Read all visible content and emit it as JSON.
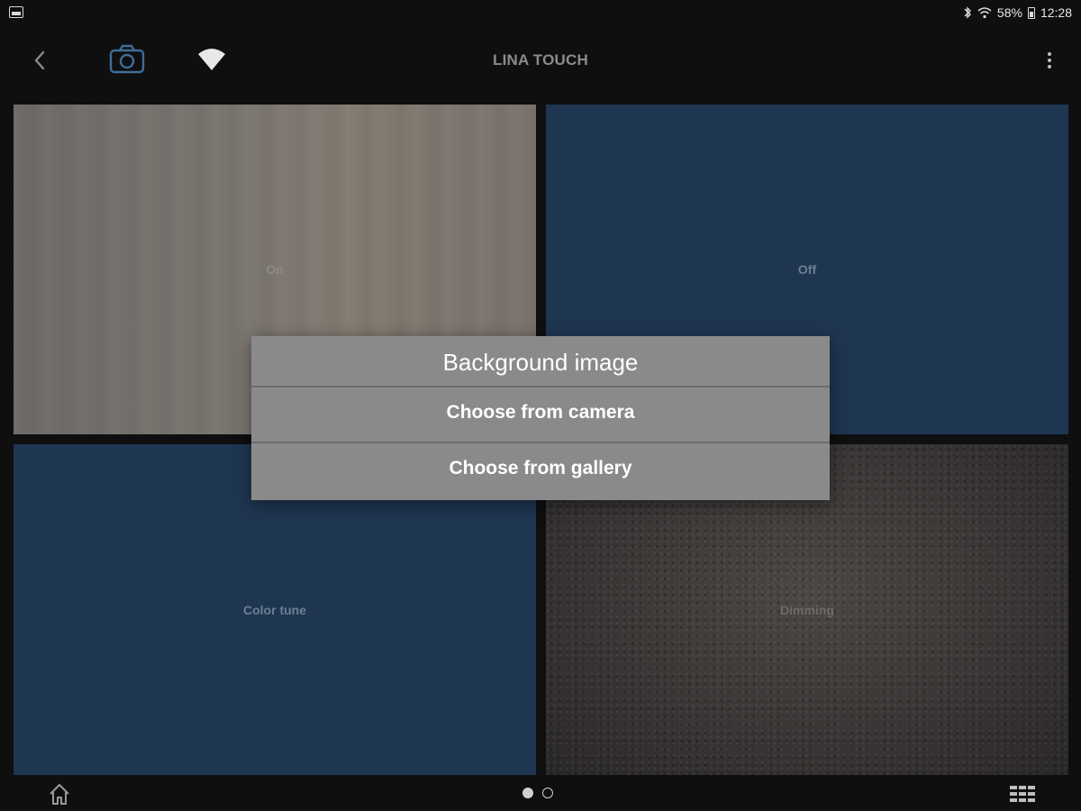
{
  "status_bar": {
    "battery_percent": "58%",
    "time": "12:28",
    "left_icon": "gallery-notification-icon",
    "icons": [
      "bluetooth-icon",
      "wifi-signal-icon",
      "battery-icon"
    ]
  },
  "app_bar": {
    "title": "LINA TOUCH",
    "icons": [
      "back-arrow-icon",
      "camera-icon",
      "wifi-icon",
      "more-vert-icon"
    ]
  },
  "tiles": [
    {
      "label": "On",
      "background": "wood-texture",
      "color": "#756f6a"
    },
    {
      "label": "Off",
      "background": "solid",
      "color": "#1f3652"
    },
    {
      "label": "Color tune",
      "background": "solid",
      "color": "#1f3652"
    },
    {
      "label": "Dimming",
      "background": "leather-texture",
      "color": "#393635"
    }
  ],
  "dialog": {
    "title": "Background image",
    "options": [
      "Choose from camera",
      "Choose from gallery"
    ]
  },
  "bottom_bar": {
    "icons": [
      "home-icon",
      "grid-menu-icon"
    ],
    "page_indicator": {
      "pages": 2,
      "current": 1
    }
  },
  "colors": {
    "background": "#0f0f10",
    "tile_blue": "#1f3652",
    "dialog_bg": "#8a8a8a",
    "title_gray": "#8b8b8b"
  }
}
